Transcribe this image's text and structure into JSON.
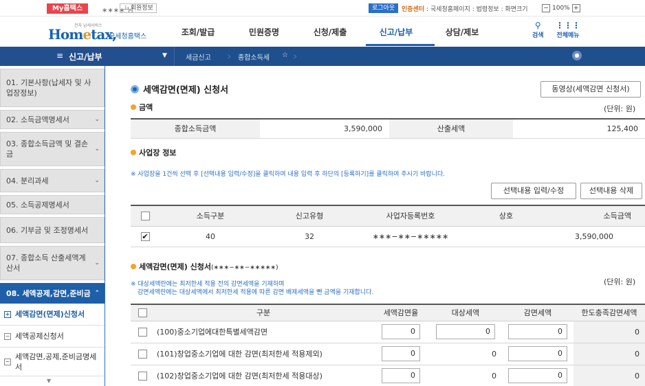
{
  "util": {
    "mytax": "My홈택스",
    "username": "∗∗∗∗ 님",
    "member_info": "회원정보",
    "logout": "로그아웃",
    "cert_center": "인증센터",
    "links": " : 국세청홈페이지 : 법령정보 : 화면크기",
    "zoom_minus": "−",
    "zoom_value": "100%",
    "zoom_plus": "+"
  },
  "header": {
    "logo_main_a": "Hom",
    "logo_main_b": "e",
    "logo_main_c": "tax,",
    "logo_sub": "국세청홈택스",
    "logo_tiny": "전자 납세서비스",
    "gnb": [
      "조회/발급",
      "민원증명",
      "신청/제출",
      "신고/납부",
      "상담/제보"
    ],
    "search_label": "검색",
    "allmenu_label": "전체메뉴"
  },
  "locbar": {
    "menu_title": "신고/납부",
    "crumb1": "세금신고",
    "crumb2": "종합소득세"
  },
  "sidebar": {
    "items": [
      {
        "label": "01. 기본사항(납세자 및 사업장정보)"
      },
      {
        "label": "02. 소득금액명세서"
      },
      {
        "label": "03. 종합소득금액 및 결손금"
      },
      {
        "label": "04. 분리과세"
      },
      {
        "label": "05. 소득공제명세서"
      },
      {
        "label": "06. 기부금 및 조정명세서"
      },
      {
        "label": "07. 종합소득 산출세액계산서"
      },
      {
        "label": "08. 세액공제,감면,준비금"
      }
    ],
    "subs": [
      {
        "label": "세액감면(면제)신청서"
      },
      {
        "label": "세액공제신청서"
      },
      {
        "label": "세액감면,공제,준비금명세서"
      }
    ]
  },
  "page": {
    "title": "세액감면(면제) 신청서",
    "video_button": "동영상(세액감면 신청서)",
    "unit": "(단위: 원)",
    "amount_section": "금액",
    "amount": {
      "income_label": "종합소득금액",
      "income_value": "3,590,000",
      "tax_label": "산출세액",
      "tax_value": "125,400"
    },
    "biz_section": "사업장 정보",
    "biz_note": "※ 사업장을 1건씩 선택 후 [선택내용 입력/수정]을 클릭하여 내용 입력 후 하단의 [등록하기]를 클릭하여 주시기 바랍니다.",
    "btn_edit": "선택내용 입력/수정",
    "btn_delete": "선택내용 삭제",
    "biz_headers": [
      "소득구분",
      "신고유형",
      "사업자등록번호",
      "상호",
      "소득금액"
    ],
    "biz_rows": [
      {
        "checked": "✔",
        "income_type": "40",
        "report_type": "32",
        "reg_no": "∗∗∗−∗∗−∗∗∗∗∗",
        "name": "",
        "amount": "3,590,000"
      }
    ],
    "reduction_section": "세액감면(면제) 신청서",
    "reduction_section_suffix": "(∗∗∗−∗∗−∗∗∗∗∗)",
    "reduction_note1": "※ 대상세액란에는 최저한세 적용 전의 감면세액을 기재하며",
    "reduction_note2": "감면세액란에는 대상세액에서 최저한세 적용에 따른 감면 배제세액을 뺀 금액을 기재합니다.",
    "reduction_headers": [
      "구분",
      "세액감면율",
      "대상세액",
      "감면세액",
      "한도충족감면세액"
    ],
    "reduction_rows": [
      {
        "label": "(100)중소기업에대한특별세액감면",
        "rate": "0",
        "target": "0",
        "reduction": "0",
        "limit": "0"
      },
      {
        "label": "(101)창업중소기업에 대한 감면(최저한세 적용제외)",
        "rate": "0",
        "target": "0",
        "reduction": "0",
        "limit": "0"
      },
      {
        "label": "(102)창업중소기업에 대한 감면(최저한세 적용대상)",
        "rate": "0",
        "target": "0",
        "reduction": "0",
        "limit": "0"
      }
    ]
  }
}
